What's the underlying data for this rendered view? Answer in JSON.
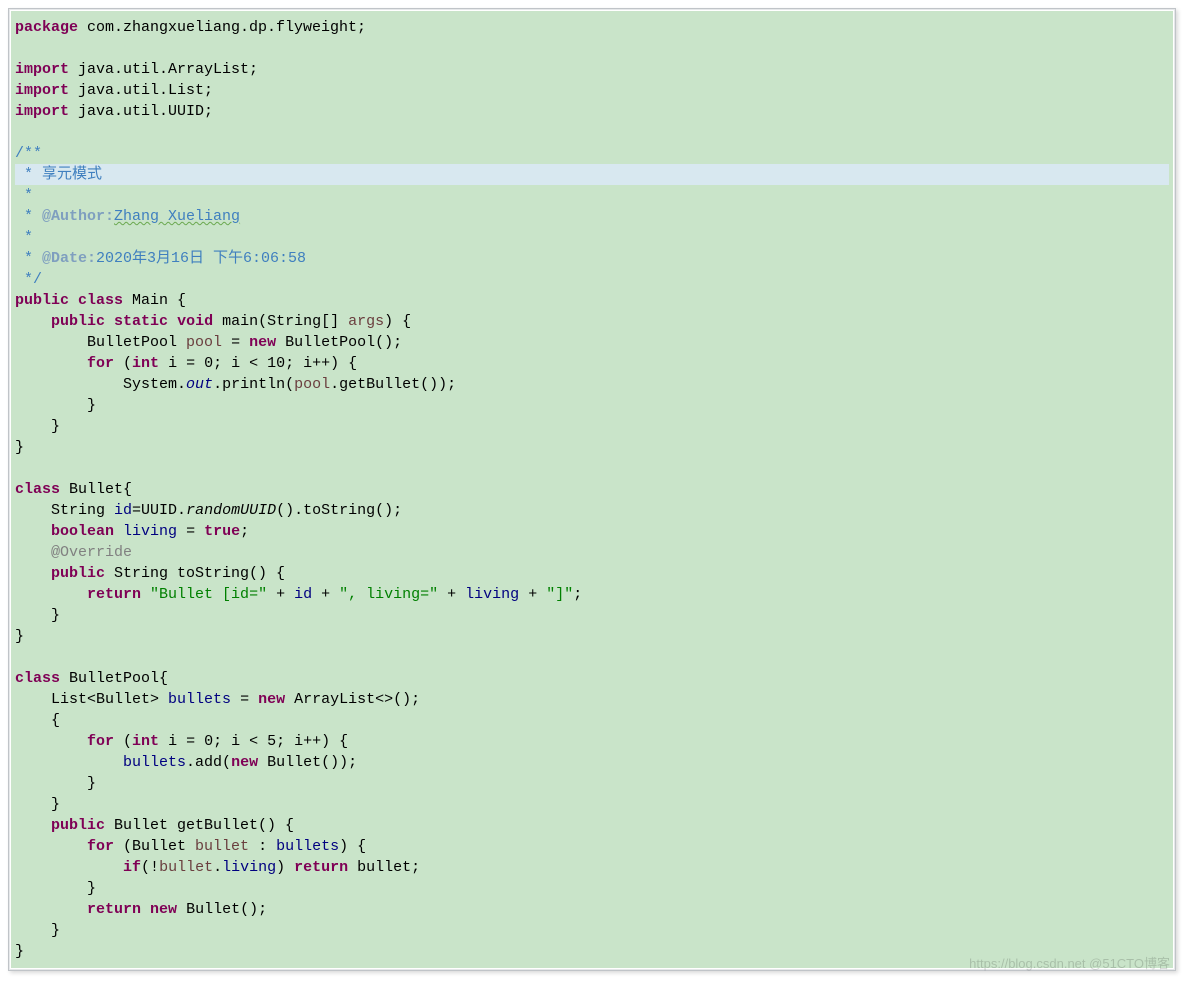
{
  "code": {
    "pkgKw": "package",
    "pkgName": " com.zhangxueliang.dp.flyweight;",
    "importKw": "import",
    "imp1": " java.util.ArrayList;",
    "imp2": " java.util.List;",
    "imp3": " java.util.UUID;",
    "jdOpen": "/**",
    "jdLine1": " * 享元模式",
    "jdStar": " *",
    "jdAuthTag": "@Author:",
    "jdAuthPre": " * ",
    "jdAuthVal": "Zhang Xueliang",
    "jdDateTag": "@Date:",
    "jdDateVal": "2020年3月16日 下午6:06:58",
    "jdClose": " */",
    "publicKw": "public",
    "classKw": "class",
    "mainCls": " Main {",
    "staticKw": "static",
    "voidKw": "void",
    "mainSig1": " main(String[] ",
    "argsParm": "args",
    "mainSig2": ") {",
    "bpType": "BulletPool ",
    "poolVar": "pool",
    "eq": " = ",
    "newKw": "new",
    "bpCtor": " BulletPool();",
    "forKw": "for",
    "intKw": "int",
    "forOpen": " (",
    "forBody": " i = 0; i < 10; i++) {",
    "sysOut1": "System.",
    "outFld": "out",
    "sysOut2": ".println(",
    "poolRef": "pool",
    "getB": ".getBullet());",
    "closeBr": "}",
    "bulletCls": " Bullet{",
    "strTy": "String ",
    "idFld": "id",
    "idAssign1": "=UUID.",
    "randomUUID": "randomUUID",
    "idAssign2": "().toString();",
    "boolKw": "boolean",
    "livingFld": "living",
    "trueKw": "true",
    "semicolon": ";",
    "override": "@Override",
    "toStrSig": " String toString() {",
    "returnKw": "return",
    "str1": "\"Bullet [id=\"",
    "plus": " + ",
    "str2": "\", living=\"",
    "str3": "\"]\"",
    "bpCls": " BulletPool{",
    "listDecl1": "List<Bullet> ",
    "bulletsFld": "bullets",
    "arrList": " ArrayList<>();",
    "openBr": "{",
    "for5Body": " i = 0; i < 5; i++) {",
    "bulletsAdd1": ".add(",
    "bulletCtor": " Bullet());",
    "getBSig": " Bullet getBullet() {",
    "forEach1": " (Bullet ",
    "bulletVar": "bullet",
    "forEach2": " : ",
    "forEach3": ") {",
    "ifKw": "if",
    "ifCond1": "(!",
    "ifCond2": ".",
    "ifCond3": ") ",
    "retBullet": " bullet;",
    "retNewBullet": " Bullet();"
  },
  "watermark": "https://blog.csdn.net @51CTO博客"
}
